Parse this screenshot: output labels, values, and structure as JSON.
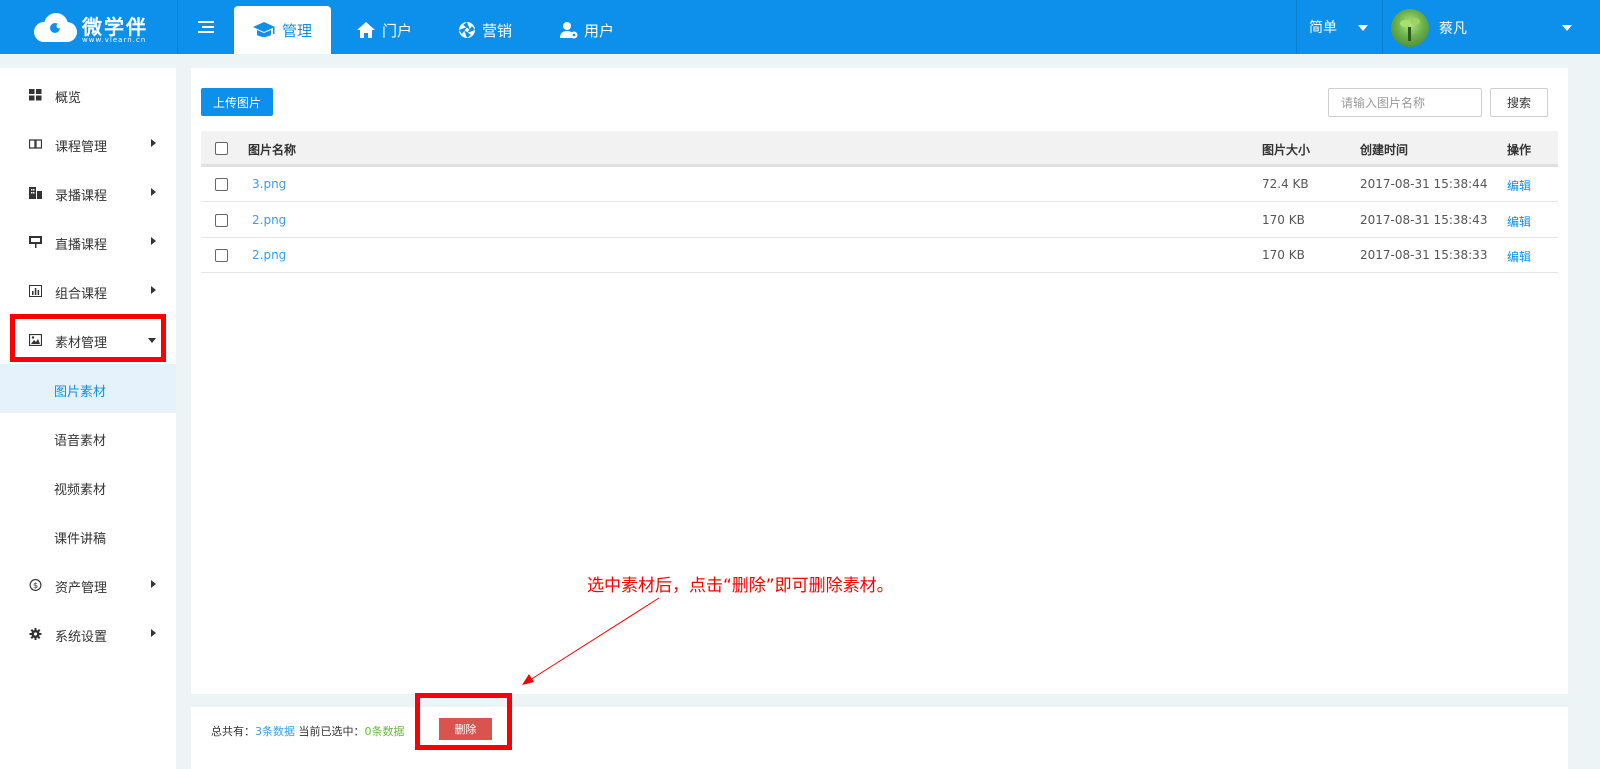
{
  "brand": {
    "name": "微学伴",
    "url": "www.vlearn.cn"
  },
  "nav": {
    "tabs": [
      {
        "label": "管理",
        "icon": "graduation-cap-icon",
        "active": true
      },
      {
        "label": "门户",
        "icon": "home-icon",
        "active": false
      },
      {
        "label": "营销",
        "icon": "aperture-icon",
        "active": false
      },
      {
        "label": "用户",
        "icon": "user-gear-icon",
        "active": false
      }
    ],
    "language": "简单",
    "user_name": "蔡凡"
  },
  "sidebar": {
    "items": [
      {
        "label": "概览",
        "icon": "grid-icon",
        "has_children": false
      },
      {
        "label": "课程管理",
        "icon": "book-icon",
        "has_children": true
      },
      {
        "label": "录播课程",
        "icon": "building-icon",
        "has_children": true
      },
      {
        "label": "直播课程",
        "icon": "presentation-icon",
        "has_children": true
      },
      {
        "label": "组合课程",
        "icon": "bar-chart-icon",
        "has_children": true
      },
      {
        "label": "素材管理",
        "icon": "image-icon",
        "has_children": true,
        "expanded": true
      },
      {
        "label": "资产管理",
        "icon": "dollar-circle-icon",
        "has_children": true
      },
      {
        "label": "系统设置",
        "icon": "gear-icon",
        "has_children": true
      }
    ],
    "subitems": [
      {
        "label": "图片素材",
        "active": true
      },
      {
        "label": "语音素材",
        "active": false
      },
      {
        "label": "视频素材",
        "active": false
      },
      {
        "label": "课件讲稿",
        "active": false
      }
    ]
  },
  "toolbar": {
    "upload_label": "上传图片",
    "search_placeholder": "请输入图片名称",
    "search_label": "搜索"
  },
  "table": {
    "headers": {
      "name": "图片名称",
      "size": "图片大小",
      "time": "创建时间",
      "op": "操作"
    },
    "rows": [
      {
        "name": "3.png",
        "size": "72.4 KB",
        "time": "2017-08-31 15:38:44",
        "op": "编辑"
      },
      {
        "name": "2.png",
        "size": "170 KB",
        "time": "2017-08-31 15:38:43",
        "op": "编辑"
      },
      {
        "name": "2.png",
        "size": "170 KB",
        "time": "2017-08-31 15:38:33",
        "op": "编辑"
      }
    ]
  },
  "annotation": "选中素材后，点击“删除”即可删除素材。",
  "footer": {
    "total_prefix": "总共有：",
    "total_value": "3条数据",
    "selected_prefix": "当前已选中：",
    "selected_value": "0条数据",
    "delete_label": "删除"
  },
  "colors": {
    "primary": "#0c90ec",
    "highlight_red": "#fb0000",
    "delete_red": "#d9534f",
    "link_blue": "#3b9ee4",
    "selected_green": "#6ab83b"
  }
}
